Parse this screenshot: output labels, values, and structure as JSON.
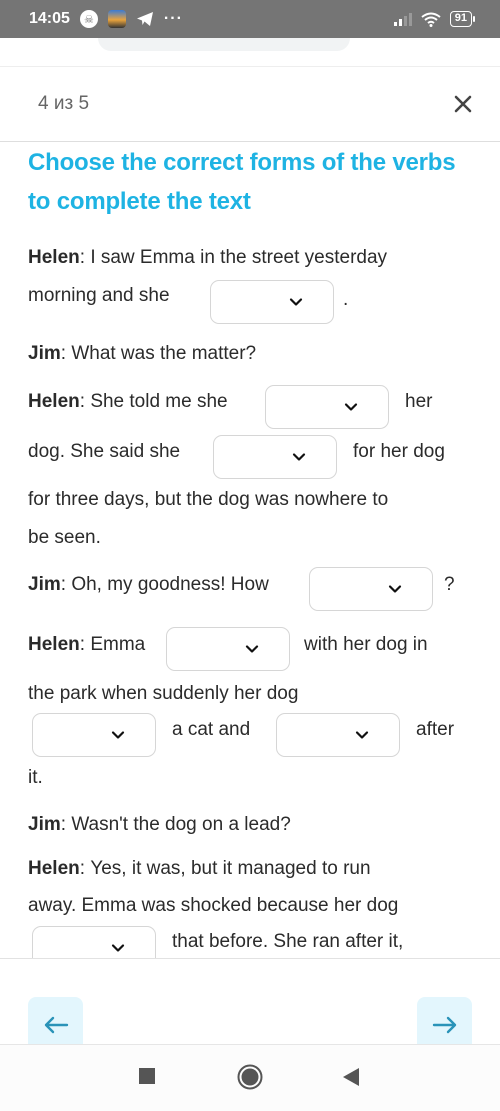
{
  "status_bar": {
    "time": "14:05",
    "notification_icons": [
      "skull-app-icon",
      "game-app-icon",
      "telegram-icon"
    ],
    "more": "···",
    "battery": "91"
  },
  "header": {
    "counter": "4 из 5",
    "close_label": "×"
  },
  "task": {
    "title": "Choose the correct forms of the verbs to complete the text"
  },
  "dialogue": {
    "l1": {
      "speaker": "Helen",
      "text": "I saw Emma in the street yesterday"
    },
    "l2": {
      "text": "morning and she",
      "after": "."
    },
    "l3": {
      "speaker": "Jim",
      "text": "What was the matter?"
    },
    "l4": {
      "speaker": "Helen",
      "text": "She told me she",
      "after": "her"
    },
    "l5": {
      "text": "dog. She said she",
      "after": "for her dog"
    },
    "l6": {
      "text": "for three days, but the dog was nowhere to"
    },
    "l7": {
      "text": "be seen."
    },
    "l8": {
      "speaker": "Jim",
      "text": "Oh, my goodness! How",
      "after": "?"
    },
    "l9": {
      "speaker": "Helen",
      "text": "Emma",
      "after": "with her dog in"
    },
    "l10": {
      "text": "the park when suddenly her dog"
    },
    "l11": {
      "middle": "a cat and",
      "after": "after"
    },
    "l12": {
      "text": "it."
    },
    "l13": {
      "speaker": "Jim",
      "text": "Wasn't the dog on a lead?"
    },
    "l14": {
      "speaker": "Helen",
      "text": "Yes, it was, but it managed to run"
    },
    "l15": {
      "text": "away. Emma was shocked because her dog"
    },
    "l16": {
      "after": "that before. She ran after it,"
    }
  },
  "selects": [
    {
      "id": 1,
      "value": ""
    },
    {
      "id": 2,
      "value": ""
    },
    {
      "id": 3,
      "value": ""
    },
    {
      "id": 4,
      "value": ""
    },
    {
      "id": 5,
      "value": ""
    },
    {
      "id": 6,
      "value": ""
    },
    {
      "id": 7,
      "value": ""
    },
    {
      "id": 8,
      "value": ""
    }
  ],
  "navigation": {
    "prev_icon": "arrow-left-icon",
    "next_icon": "arrow-right-icon"
  },
  "colors": {
    "accent": "#1eb3e3",
    "nav_button_bg": "#e3f6fd",
    "nav_arrow": "#2a93b8",
    "status_bar": "#757575"
  }
}
